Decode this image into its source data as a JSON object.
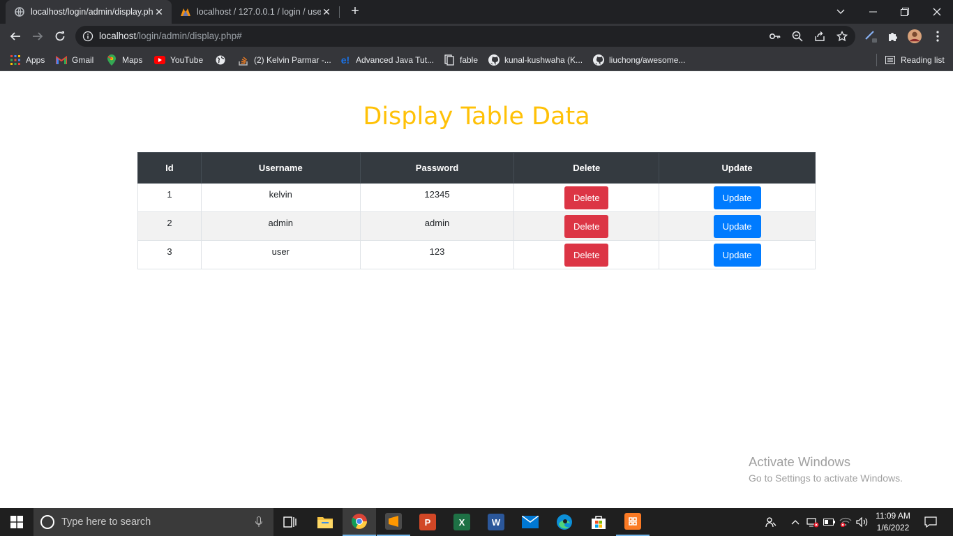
{
  "browser": {
    "tabs": [
      {
        "title": "localhost/login/admin/display.ph",
        "active": true
      },
      {
        "title": "localhost / 127.0.0.1 / login / user",
        "active": false
      }
    ],
    "url": {
      "host": "localhost",
      "path": "/login/admin/display.php#"
    },
    "bookmarks": [
      {
        "label": "Apps",
        "icon": "apps-grid-icon"
      },
      {
        "label": "Gmail",
        "icon": "gmail-icon"
      },
      {
        "label": "Maps",
        "icon": "maps-icon"
      },
      {
        "label": "YouTube",
        "icon": "youtube-icon"
      },
      {
        "label": "",
        "icon": "globe-icon"
      },
      {
        "label": "(2) Kelvin Parmar -...",
        "icon": "stackoverflow-icon"
      },
      {
        "label": "Advanced Java Tut...",
        "icon": "edureka-icon"
      },
      {
        "label": "fable",
        "icon": "page-icon"
      },
      {
        "label": "kunal-kushwaha (K...",
        "icon": "github-icon"
      },
      {
        "label": "liuchong/awesome...",
        "icon": "github-icon"
      }
    ],
    "reading_list": "Reading list"
  },
  "page": {
    "title": "Display Table Data",
    "table": {
      "headers": [
        "Id",
        "Username",
        "Password",
        "Delete",
        "Update"
      ],
      "rows": [
        {
          "id": "1",
          "username": "kelvin",
          "password": "12345",
          "delete": "Delete",
          "update": "Update"
        },
        {
          "id": "2",
          "username": "admin",
          "password": "admin",
          "delete": "Delete",
          "update": "Update"
        },
        {
          "id": "3",
          "username": "user",
          "password": "123",
          "delete": "Delete",
          "update": "Update"
        }
      ]
    },
    "watermark": {
      "line1": "Activate Windows",
      "line2": "Go to Settings to activate Windows."
    }
  },
  "taskbar": {
    "search_placeholder": "Type here to search",
    "time": "11:09 AM",
    "date": "1/6/2022"
  },
  "colors": {
    "title": "#ffc107",
    "danger": "#dc3545",
    "primary": "#007bff",
    "table_header": "#343a40"
  }
}
